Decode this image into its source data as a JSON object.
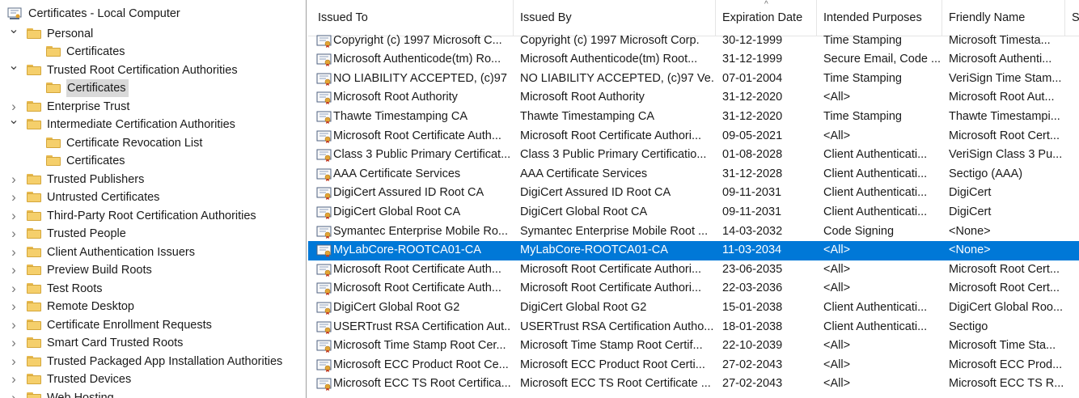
{
  "tree": {
    "root_label": "Certificates - Local Computer",
    "items": [
      {
        "label": "Personal",
        "level": 0,
        "chevron": "down",
        "selected": false
      },
      {
        "label": "Certificates",
        "level": 1,
        "chevron": "none",
        "selected": false
      },
      {
        "label": "Trusted Root Certification Authorities",
        "level": 0,
        "chevron": "down",
        "selected": false
      },
      {
        "label": "Certificates",
        "level": 1,
        "chevron": "none",
        "selected": true
      },
      {
        "label": "Enterprise Trust",
        "level": 0,
        "chevron": "right",
        "selected": false
      },
      {
        "label": "Intermediate Certification Authorities",
        "level": 0,
        "chevron": "down",
        "selected": false
      },
      {
        "label": "Certificate Revocation List",
        "level": 1,
        "chevron": "none",
        "selected": false
      },
      {
        "label": "Certificates",
        "level": 1,
        "chevron": "none",
        "selected": false
      },
      {
        "label": "Trusted Publishers",
        "level": 0,
        "chevron": "right",
        "selected": false
      },
      {
        "label": "Untrusted Certificates",
        "level": 0,
        "chevron": "right",
        "selected": false
      },
      {
        "label": "Third-Party Root Certification Authorities",
        "level": 0,
        "chevron": "right",
        "selected": false
      },
      {
        "label": "Trusted People",
        "level": 0,
        "chevron": "right",
        "selected": false
      },
      {
        "label": "Client Authentication Issuers",
        "level": 0,
        "chevron": "right",
        "selected": false
      },
      {
        "label": "Preview Build Roots",
        "level": 0,
        "chevron": "right",
        "selected": false
      },
      {
        "label": "Test Roots",
        "level": 0,
        "chevron": "right",
        "selected": false
      },
      {
        "label": "Remote Desktop",
        "level": 0,
        "chevron": "right",
        "selected": false
      },
      {
        "label": "Certificate Enrollment Requests",
        "level": 0,
        "chevron": "right",
        "selected": false
      },
      {
        "label": "Smart Card Trusted Roots",
        "level": 0,
        "chevron": "right",
        "selected": false
      },
      {
        "label": "Trusted Packaged App Installation Authorities",
        "level": 0,
        "chevron": "right",
        "selected": false
      },
      {
        "label": "Trusted Devices",
        "level": 0,
        "chevron": "right",
        "selected": false
      },
      {
        "label": "Web Hosting",
        "level": 0,
        "chevron": "right",
        "selected": false
      }
    ]
  },
  "list": {
    "columns": [
      "Issued To",
      "Issued By",
      "Expiration Date",
      "Intended Purposes",
      "Friendly Name",
      "S"
    ],
    "sort_indicator": "^",
    "rows": [
      {
        "issued_to": "Copyright (c) 1997 Microsoft C...",
        "issued_by": "Copyright (c) 1997 Microsoft Corp.",
        "expiration": "30-12-1999",
        "purposes": "Time Stamping",
        "friendly": "Microsoft Timesta...",
        "selected": false
      },
      {
        "issued_to": "Microsoft Authenticode(tm) Ro...",
        "issued_by": "Microsoft Authenticode(tm) Root...",
        "expiration": "31-12-1999",
        "purposes": "Secure Email, Code ...",
        "friendly": "Microsoft Authenti...",
        "selected": false
      },
      {
        "issued_to": "NO LIABILITY ACCEPTED, (c)97 ...",
        "issued_by": "NO LIABILITY ACCEPTED, (c)97 Ve...",
        "expiration": "07-01-2004",
        "purposes": "Time Stamping",
        "friendly": "VeriSign Time Stam...",
        "selected": false
      },
      {
        "issued_to": "Microsoft Root Authority",
        "issued_by": "Microsoft Root Authority",
        "expiration": "31-12-2020",
        "purposes": "<All>",
        "friendly": "Microsoft Root Aut...",
        "selected": false
      },
      {
        "issued_to": "Thawte Timestamping CA",
        "issued_by": "Thawte Timestamping CA",
        "expiration": "31-12-2020",
        "purposes": "Time Stamping",
        "friendly": "Thawte Timestampi...",
        "selected": false
      },
      {
        "issued_to": "Microsoft Root Certificate Auth...",
        "issued_by": "Microsoft Root Certificate Authori...",
        "expiration": "09-05-2021",
        "purposes": "<All>",
        "friendly": "Microsoft Root Cert...",
        "selected": false
      },
      {
        "issued_to": "Class 3 Public Primary Certificat...",
        "issued_by": "Class 3 Public Primary Certificatio...",
        "expiration": "01-08-2028",
        "purposes": "Client Authenticati...",
        "friendly": "VeriSign Class 3 Pu...",
        "selected": false
      },
      {
        "issued_to": "AAA Certificate Services",
        "issued_by": "AAA Certificate Services",
        "expiration": "31-12-2028",
        "purposes": "Client Authenticati...",
        "friendly": "Sectigo (AAA)",
        "selected": false
      },
      {
        "issued_to": "DigiCert Assured ID Root CA",
        "issued_by": "DigiCert Assured ID Root CA",
        "expiration": "09-11-2031",
        "purposes": "Client Authenticati...",
        "friendly": "DigiCert",
        "selected": false
      },
      {
        "issued_to": "DigiCert Global Root CA",
        "issued_by": "DigiCert Global Root CA",
        "expiration": "09-11-2031",
        "purposes": "Client Authenticati...",
        "friendly": "DigiCert",
        "selected": false
      },
      {
        "issued_to": "Symantec Enterprise Mobile Ro...",
        "issued_by": "Symantec Enterprise Mobile Root ...",
        "expiration": "14-03-2032",
        "purposes": "Code Signing",
        "friendly": "<None>",
        "selected": false
      },
      {
        "issued_to": "MyLabCore-ROOTCA01-CA",
        "issued_by": "MyLabCore-ROOTCA01-CA",
        "expiration": "11-03-2034",
        "purposes": "<All>",
        "friendly": "<None>",
        "selected": true
      },
      {
        "issued_to": "Microsoft Root Certificate Auth...",
        "issued_by": "Microsoft Root Certificate Authori...",
        "expiration": "23-06-2035",
        "purposes": "<All>",
        "friendly": "Microsoft Root Cert...",
        "selected": false
      },
      {
        "issued_to": "Microsoft Root Certificate Auth...",
        "issued_by": "Microsoft Root Certificate Authori...",
        "expiration": "22-03-2036",
        "purposes": "<All>",
        "friendly": "Microsoft Root Cert...",
        "selected": false
      },
      {
        "issued_to": "DigiCert Global Root G2",
        "issued_by": "DigiCert Global Root G2",
        "expiration": "15-01-2038",
        "purposes": "Client Authenticati...",
        "friendly": "DigiCert Global Roo...",
        "selected": false
      },
      {
        "issued_to": "USERTrust RSA Certification Aut...",
        "issued_by": "USERTrust RSA Certification Autho...",
        "expiration": "18-01-2038",
        "purposes": "Client Authenticati...",
        "friendly": "Sectigo",
        "selected": false
      },
      {
        "issued_to": "Microsoft Time Stamp Root Cer...",
        "issued_by": "Microsoft Time Stamp Root Certif...",
        "expiration": "22-10-2039",
        "purposes": "<All>",
        "friendly": "Microsoft Time Sta...",
        "selected": false
      },
      {
        "issued_to": "Microsoft ECC Product Root Ce...",
        "issued_by": "Microsoft ECC Product Root Certi...",
        "expiration": "27-02-2043",
        "purposes": "<All>",
        "friendly": "Microsoft ECC Prod...",
        "selected": false
      },
      {
        "issued_to": "Microsoft ECC TS Root Certifica...",
        "issued_by": "Microsoft ECC TS Root Certificate ...",
        "expiration": "27-02-2043",
        "purposes": "<All>",
        "friendly": "Microsoft ECC TS R...",
        "selected": false
      }
    ]
  },
  "colors": {
    "selection": "#0078d7",
    "tree_selection": "#d9d9d9",
    "folder": "#f5cf6b"
  },
  "icons": {
    "tree_root": "certificate-store-icon",
    "folder": "folder-icon",
    "certificate": "certificate-icon",
    "expand": "chevron-right-icon",
    "collapse": "chevron-down-icon"
  }
}
